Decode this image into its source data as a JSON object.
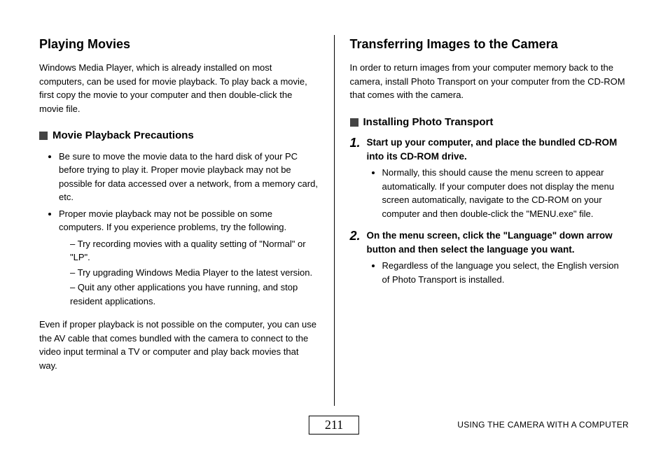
{
  "left": {
    "heading": "Playing Movies",
    "intro": "Windows Media Player, which is already installed on most computers, can be used for movie playback. To play back a movie, first copy the movie to your computer and then double-click the movie file.",
    "sub_heading": "Movie Playback Precautions",
    "bullets": {
      "b1": "Be sure to move the movie data to the hard disk of your PC before trying to play it. Proper movie playback may not be possible for data accessed over a network, from a memory card, etc.",
      "b2": "Proper movie playback may not be possible on some computers. If you experience problems, try the following.",
      "d1": "Try recording movies with a quality setting of \"Normal\" or \"LP\".",
      "d2": "Try upgrading Windows Media Player to the latest version.",
      "d3": "Quit any other applications you have running, and stop resident applications."
    },
    "closing": "Even if proper playback is not possible on the computer, you can use the AV cable that comes bundled with the camera to connect to the video input terminal a TV or computer and play back movies that way."
  },
  "right": {
    "heading": "Transferring Images to the Camera",
    "intro": "In order to return images from your computer memory back to the camera, install Photo Transport on your computer from the CD-ROM that comes with the camera.",
    "sub_heading": "Installing Photo Transport",
    "step1": {
      "num": "1.",
      "head": "Start up your computer, and place the bundled CD-ROM into its CD-ROM drive.",
      "bullet": "Normally, this should cause the menu screen to appear automatically. If your computer does not display the menu screen automatically, navigate to the CD-ROM on your computer and then double-click the \"MENU.exe\" file."
    },
    "step2": {
      "num": "2.",
      "head": "On the menu screen, click the \"Language\" down arrow button and then select the language you want.",
      "bullet": "Regardless of the language you select, the English version of Photo Transport is installed."
    }
  },
  "footer": {
    "page_number": "211",
    "label": "USING THE CAMERA WITH A COMPUTER"
  }
}
